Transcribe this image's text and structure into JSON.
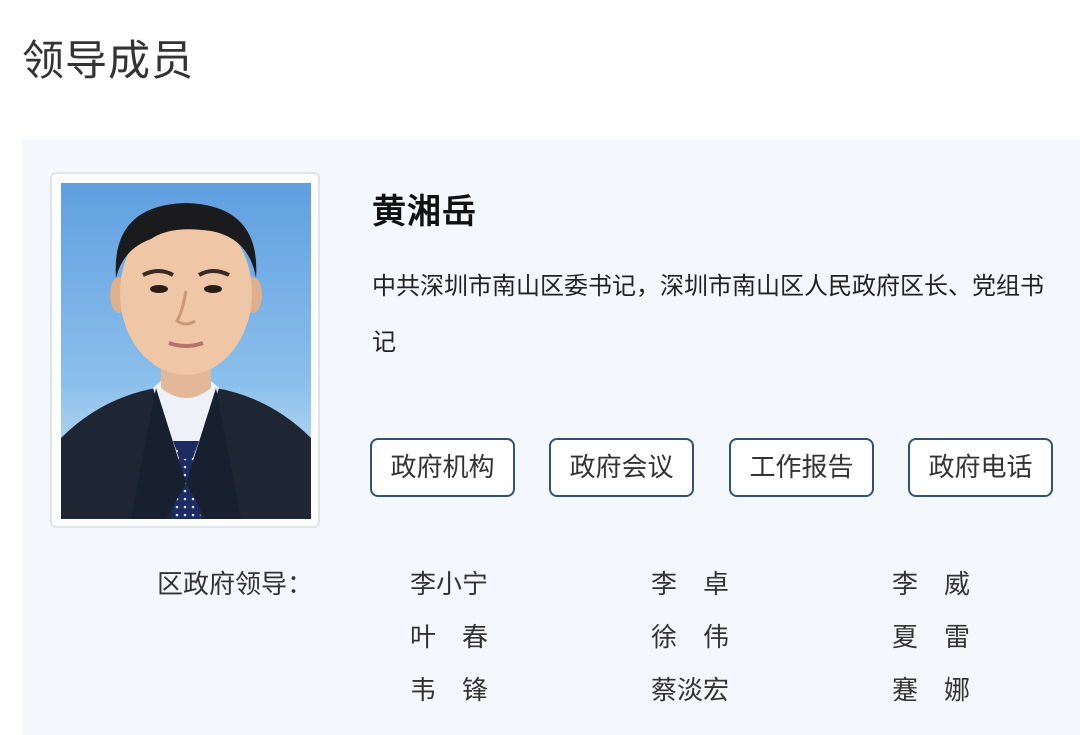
{
  "page": {
    "title": "领导成员"
  },
  "leader": {
    "name": "黄湘岳",
    "title": "中共深圳市南山区委书记，深圳市南山区人民政府区长、党组书记"
  },
  "buttons": [
    {
      "label": "政府机构"
    },
    {
      "label": "政府会议"
    },
    {
      "label": "工作报告"
    },
    {
      "label": "政府电话"
    }
  ],
  "leaders_section": {
    "label": "区政府领导：",
    "names": [
      [
        "李小宁",
        "李　卓",
        "李　威"
      ],
      [
        "叶　春",
        "徐　伟",
        "夏　雷"
      ],
      [
        "韦　锋",
        "蔡淡宏",
        "蹇　娜"
      ]
    ]
  },
  "colors": {
    "panel_bg": "#f4f8fc",
    "button_border": "#2f5376",
    "portrait_bg_top": "#5f9fe0",
    "portrait_bg_bottom": "#d8ecf8"
  }
}
